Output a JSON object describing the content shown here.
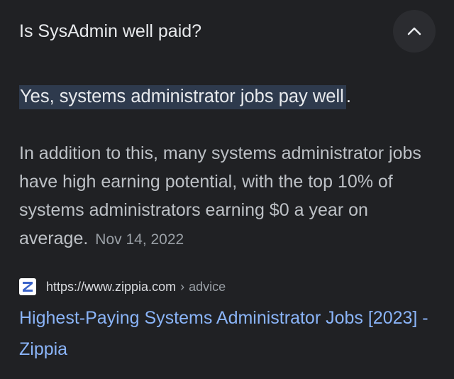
{
  "question": {
    "text": "Is SysAdmin well paid?",
    "toggle_icon": "chevron-up-icon"
  },
  "answer": {
    "highlight": "Yes, systems administrator jobs pay well",
    "trailing": "."
  },
  "detail": {
    "text": "In addition to this, many systems administrator jobs have high earning potential, with the top 10% of systems administrators earning $0 a year on average.",
    "date": "Nov 14, 2022"
  },
  "source": {
    "favicon": "zippia-logo",
    "url": "https://www.zippia.com",
    "separator": "›",
    "path": "advice"
  },
  "result": {
    "title": "Highest-Paying Systems Administrator Jobs [2023] - Zippia"
  },
  "colors": {
    "background": "#202124",
    "highlight": "#2e3a4d",
    "link": "#8ab4f8",
    "body_text": "#bdc1c6"
  }
}
